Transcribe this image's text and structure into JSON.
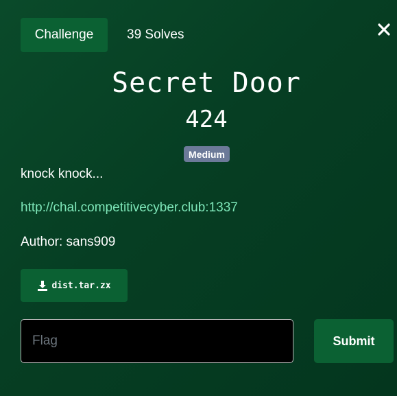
{
  "tabs": {
    "challenge_label": "Challenge",
    "solves_label": "39 Solves"
  },
  "challenge": {
    "name": "Secret Door",
    "points": "424",
    "difficulty": "Medium",
    "description": "knock knock...",
    "link": "http://chal.competitivecyber.club:1337",
    "author": "Author: sans909"
  },
  "files": [
    {
      "name": "dist.tar.zx",
      "icon": "download-icon"
    }
  ],
  "flag_form": {
    "placeholder": "Flag",
    "value": "",
    "submit_label": "Submit"
  },
  "icons": {
    "close": "close-icon"
  },
  "colors": {
    "background": "#064025",
    "button": "#0b6133",
    "badge": "#6c7a99",
    "link": "#7ee7b9",
    "input_background": "#000000"
  }
}
